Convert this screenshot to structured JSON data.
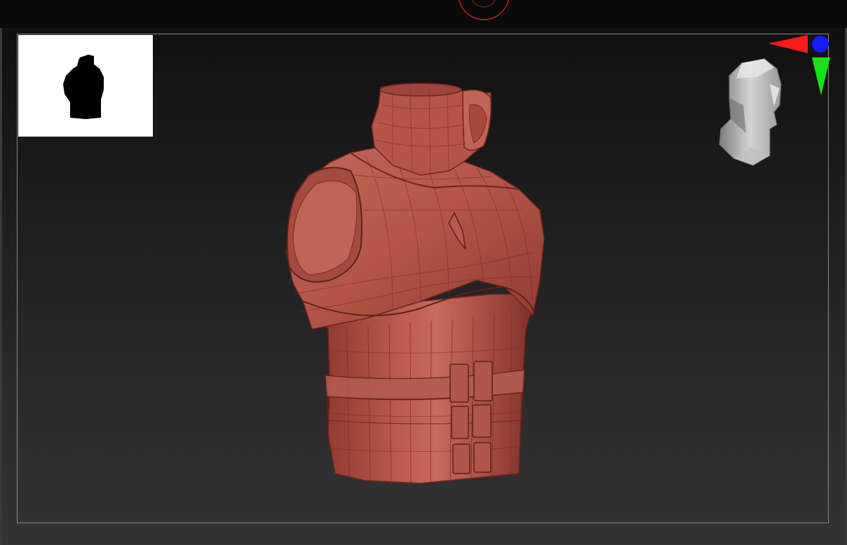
{
  "viewport": {
    "model_name": "torso-armor",
    "material_color": "#a8473b",
    "background_top": "#101010",
    "background_bottom": "#333333"
  },
  "navigator": {
    "background": "#ffffff",
    "silhouette_color": "#000000"
  },
  "gizmo": {
    "x_axis_color": "#ff1a1a",
    "y_axis_color": "#19e019",
    "z_axis_color": "#1a1aff",
    "head_icon": "head-icon"
  },
  "top_dial": {
    "icon": "dial-icon",
    "color": "#c0201c"
  }
}
